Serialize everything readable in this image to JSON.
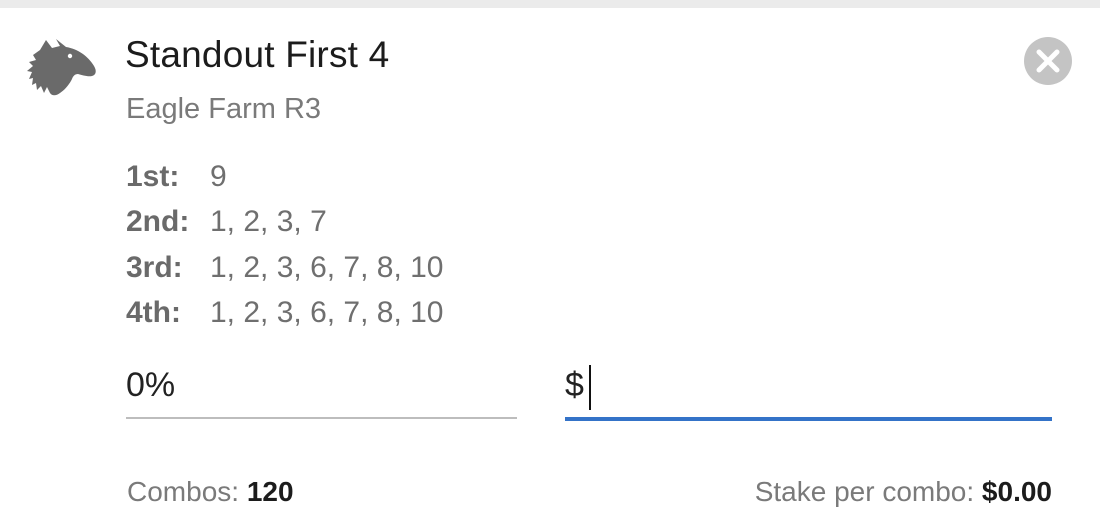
{
  "bet": {
    "title": "Standout First 4",
    "race": "Eagle Farm R3",
    "icon": "horse-head-icon"
  },
  "selections": [
    {
      "label": "1st:",
      "runners": "9"
    },
    {
      "label": "2nd:",
      "runners": "1, 2, 3, 7"
    },
    {
      "label": "3rd:",
      "runners": "1, 2, 3, 6, 7, 8, 10"
    },
    {
      "label": "4th:",
      "runners": "1, 2, 3, 6, 7, 8, 10"
    }
  ],
  "inputs": {
    "percent_value": "0%",
    "stake_prefix": "$",
    "stake_value": ""
  },
  "footer": {
    "combos_label": "Combos:",
    "combos_value": "120",
    "stake_per_combo_label": "Stake per combo:",
    "stake_per_combo_value": "$0.00"
  },
  "colors": {
    "accent": "#3473c8",
    "close_button": "#c4c4c4",
    "icon": "#6a6a6a"
  }
}
